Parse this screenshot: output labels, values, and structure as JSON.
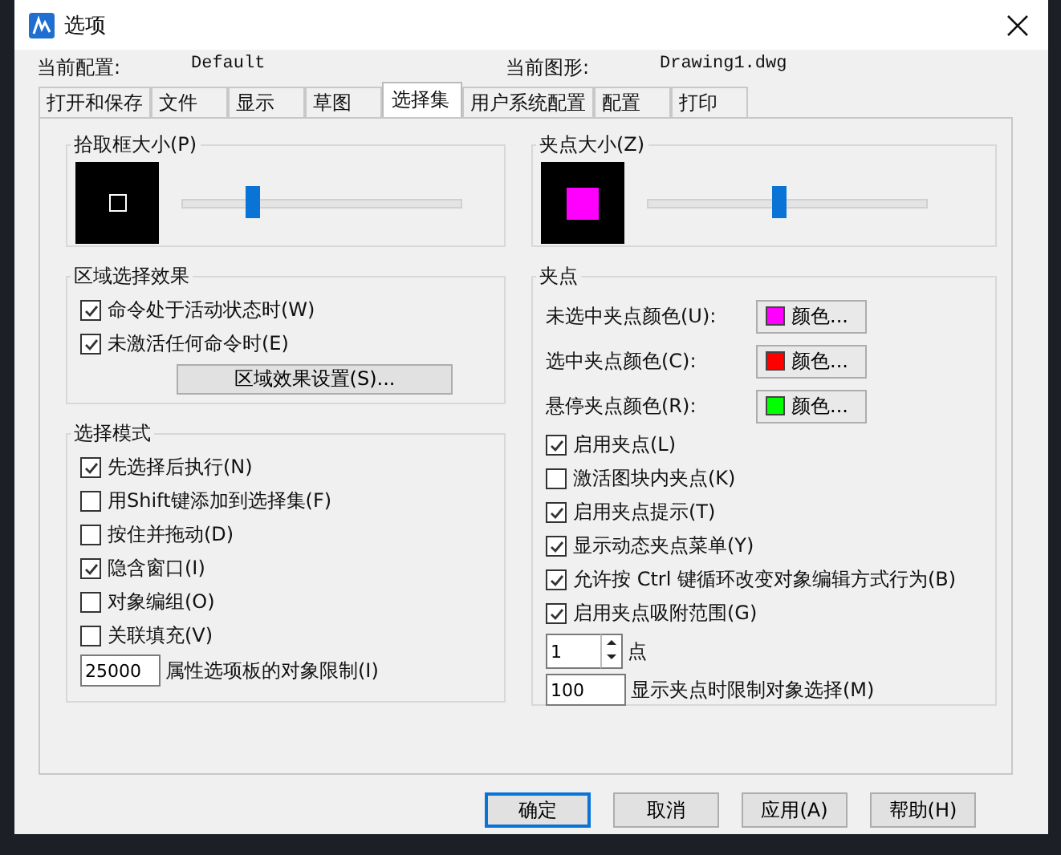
{
  "window": {
    "title": "选项"
  },
  "info": [
    {
      "label": "当前配置:",
      "value": "Default"
    },
    {
      "label": "当前图形:",
      "value": "Drawing1.dwg"
    }
  ],
  "tabs": [
    {
      "label": "打开和保存",
      "selected": false
    },
    {
      "label": "文件",
      "selected": false
    },
    {
      "label": "显示",
      "selected": false
    },
    {
      "label": "草图",
      "selected": false
    },
    {
      "label": "选择集",
      "selected": true
    },
    {
      "label": "用户系统配置",
      "selected": false
    },
    {
      "label": "配置",
      "selected": false
    },
    {
      "label": "打印",
      "selected": false
    }
  ],
  "pickbox": {
    "title": "拾取框大小(P)",
    "level": 0.25
  },
  "grip_size": {
    "title": "夹点大小(Z)",
    "level": 0.47,
    "color": "#ff00ff"
  },
  "area_selection": {
    "title": "区域选择效果",
    "options": [
      {
        "label": "命令处于活动状态时(W)",
        "checked": true
      },
      {
        "label": "未激活任何命令时(E)",
        "checked": true
      }
    ],
    "button": "区域效果设置(S)..."
  },
  "selection_modes": {
    "title": "选择模式",
    "options": [
      {
        "label": "先选择后执行(N)",
        "checked": true
      },
      {
        "label": "用Shift键添加到选择集(F)",
        "checked": false
      },
      {
        "label": "按住并拖动(D)",
        "checked": false
      },
      {
        "label": "隐含窗口(I)",
        "checked": true
      },
      {
        "label": "对象编组(O)",
        "checked": false
      },
      {
        "label": "关联填充(V)",
        "checked": false
      }
    ],
    "limit": {
      "value": "25000",
      "label": "属性选项板的对象限制(I)"
    }
  },
  "grips": {
    "title": "夹点",
    "colors": [
      {
        "label": "未选中夹点颜色(U):",
        "color": "#ff00ff",
        "button": "颜色..."
      },
      {
        "label": "选中夹点颜色(C):",
        "color": "#ff0000",
        "button": "颜色..."
      },
      {
        "label": "悬停夹点颜色(R):",
        "color": "#00ff00",
        "button": "颜色..."
      }
    ],
    "options": [
      {
        "label": "启用夹点(L)",
        "checked": true
      },
      {
        "label": "激活图块内夹点(K)",
        "checked": false
      },
      {
        "label": "启用夹点提示(T)",
        "checked": true
      },
      {
        "label": "显示动态夹点菜单(Y)",
        "checked": true
      },
      {
        "label": "允许按 Ctrl 键循环改变对象编辑方式行为(B)",
        "checked": true
      },
      {
        "label": "启用夹点吸附范围(G)",
        "checked": true
      }
    ],
    "snap": {
      "value": "1",
      "unit": "点"
    },
    "limit": {
      "value": "100",
      "label": "显示夹点时限制对象选择(M)"
    }
  },
  "buttons": [
    {
      "label": "确定",
      "default": true
    },
    {
      "label": "取消",
      "default": false
    },
    {
      "label": "应用(A)",
      "default": false
    },
    {
      "label": "帮助(H)",
      "default": false
    }
  ]
}
